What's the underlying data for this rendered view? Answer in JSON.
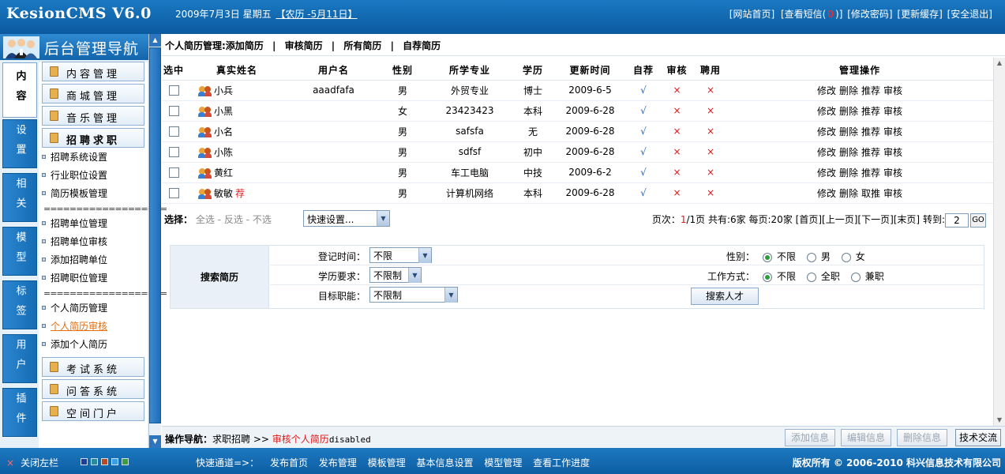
{
  "header": {
    "logo": "KesionCMS V6.0",
    "date": "2009年7月3日  星期五",
    "lunar": "【农历 -5月11日】",
    "links": [
      "[网站首页]",
      "[查看短信(",
      "0",
      ")]",
      "[修改密码]",
      "[更新缓存]",
      "[安全退出]"
    ]
  },
  "nav": {
    "title": "后台管理导航",
    "tabs": [
      "内容",
      "设置",
      "相关",
      "模型",
      "标签",
      "用户",
      "插件"
    ],
    "menus": {
      "content": "内容管理",
      "shop": "商城管理",
      "music": "音乐管理",
      "jobs": "招聘求职",
      "exam": "考试系统",
      "qa": "问答系统",
      "space": "空间门户"
    },
    "job_items": [
      "招聘系统设置",
      "行业职位设置",
      "简历模板管理"
    ],
    "separator": "===================",
    "unit_items": [
      "招聘单位管理",
      "招聘单位审核",
      "添加招聘单位",
      "招聘职位管理"
    ],
    "resume_items": [
      "个人简历管理",
      "个人简历审核",
      "添加个人简历"
    ]
  },
  "crumb": {
    "title": "个人简历管理:添加简历",
    "links": [
      "审核简历",
      "所有简历",
      "自荐简历"
    ],
    "sep": "|"
  },
  "table": {
    "headers": [
      "选中",
      "真实姓名",
      "用户名",
      "性别",
      "所学专业",
      "学历",
      "更新时间",
      "自荐",
      "审核",
      "聘用",
      "管理操作"
    ],
    "rows": [
      {
        "name": "小兵",
        "user": "aaadfafa",
        "gender": "男",
        "major": "外贸专业",
        "edu": "博士",
        "time": "2009-6-5",
        "self": "√",
        "audit": "×",
        "hire": "×",
        "ops": [
          "修改",
          "删除",
          "推荐",
          "审核"
        ],
        "tag": ""
      },
      {
        "name": "小黑",
        "user": "",
        "gender": "女",
        "major": "23423423",
        "edu": "本科",
        "time": "2009-6-28",
        "self": "√",
        "audit": "×",
        "hire": "×",
        "ops": [
          "修改",
          "删除",
          "推荐",
          "审核"
        ],
        "tag": ""
      },
      {
        "name": "小名",
        "user": "",
        "gender": "男",
        "major": "safsfa",
        "edu": "无",
        "time": "2009-6-28",
        "self": "√",
        "audit": "×",
        "hire": "×",
        "ops": [
          "修改",
          "删除",
          "推荐",
          "审核"
        ],
        "tag": ""
      },
      {
        "name": "小陈",
        "user": "",
        "gender": "男",
        "major": "sdfsf",
        "edu": "初中",
        "time": "2009-6-28",
        "self": "√",
        "audit": "×",
        "hire": "×",
        "ops": [
          "修改",
          "删除",
          "推荐",
          "审核"
        ],
        "tag": ""
      },
      {
        "name": "黄红",
        "user": "",
        "gender": "男",
        "major": "车工电脑",
        "edu": "中技",
        "time": "2009-6-2",
        "self": "√",
        "audit": "×",
        "hire": "×",
        "ops": [
          "修改",
          "删除",
          "推荐",
          "审核"
        ],
        "tag": ""
      },
      {
        "name": "敏敏",
        "user": "",
        "gender": "男",
        "major": "计算机网络",
        "edu": "本科",
        "time": "2009-6-28",
        "self": "√",
        "audit": "×",
        "hire": "×",
        "ops": [
          "修改",
          "删除",
          "取推",
          "审核"
        ],
        "tag": "荐"
      }
    ]
  },
  "select_bar": {
    "label": "选择：",
    "all": "全选",
    "inverse": "反选",
    "none": "不选",
    "dash": " - ",
    "quick_setting": "快速设置..."
  },
  "pager": {
    "prefix": "页次：",
    "current": "1",
    "total": "/1页",
    "total_count": "共有:6家",
    "per_page": "每页:20家",
    "links": "[首页][上一页][下一页][末页]",
    "goto_label": "转到:",
    "goto_value": "2",
    "go": "GO"
  },
  "search": {
    "title": "搜索简历",
    "reg_time_label": "登记时间：",
    "reg_time_value": "不限",
    "edu_label": "学历要求：",
    "edu_value": "不限制",
    "job_label": "目标职能：",
    "job_value": "不限制",
    "gender_label": "性别：",
    "gender_options": [
      "不限",
      "男",
      "女"
    ],
    "work_label": "工作方式：",
    "work_options": [
      "不限",
      "全职",
      "兼职"
    ],
    "button": "搜索人才"
  },
  "opbar": {
    "label": "操作导航：",
    "path": "求职招聘",
    "arrow": ">>",
    "current": "审核个人简历",
    "extra": "disabled",
    "buttons": [
      "添加信息",
      "编辑信息",
      "删除信息",
      "技术交流"
    ]
  },
  "status": {
    "close": "关闭左栏",
    "close_icon": "×",
    "swatch_colors": [
      "#1a3fa0",
      "#2a8a9a",
      "#b84a1e",
      "#3a9ee0",
      "#3aa03a"
    ],
    "quick_label": "快速通道=>：",
    "quick_links": [
      "发布首页",
      "发布管理",
      "模板管理",
      "基本信息设置",
      "模型管理",
      "查看工作进度"
    ],
    "copyright": "版权所有 © 2006-2010 科兴信息技术有限公司"
  }
}
